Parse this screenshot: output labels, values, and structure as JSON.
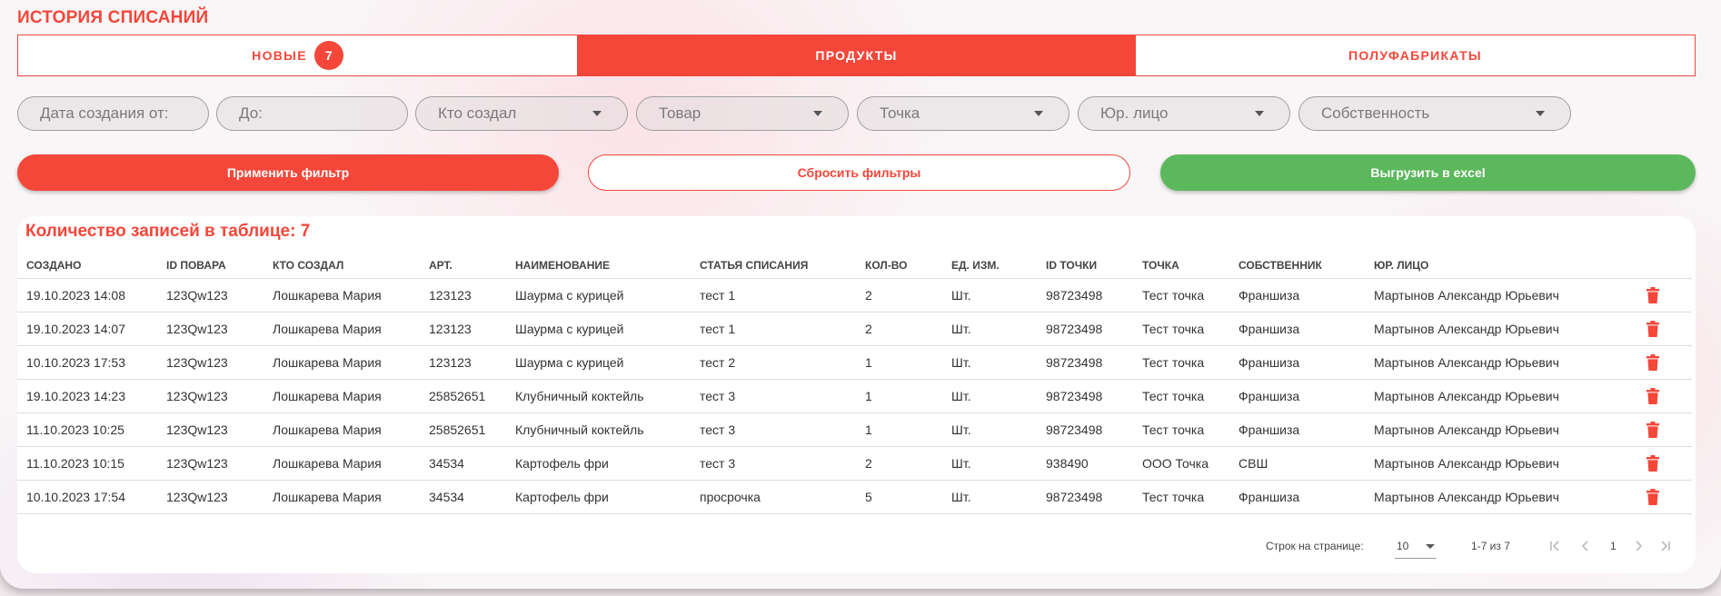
{
  "page": {
    "title": "ИСТОРИЯ СПИСАНИЙ"
  },
  "tabs": [
    {
      "label": "НОВЫЕ",
      "badge": "7"
    },
    {
      "label": "ПРОДУКТЫ"
    },
    {
      "label": "ПОЛУФАБРИКАТЫ"
    }
  ],
  "filters": {
    "date_from": "Дата создания от:",
    "date_to": "До:",
    "creator": "Кто создал",
    "product": "Товар",
    "point": "Точка",
    "legal_entity": "Юр. лицо",
    "ownership": "Собственность"
  },
  "buttons": {
    "apply": "Применить фильтр",
    "reset": "Сбросить фильтры",
    "export": "Выгрузить в excel"
  },
  "table": {
    "count_label": "Количество записей в таблице: 7",
    "columns": [
      "Создано",
      "ID повара",
      "Кто создал",
      "Арт.",
      "Наименование",
      "Статья списания",
      "Кол-во",
      "Ед. изм.",
      "ID точки",
      "Точка",
      "Собственник",
      "Юр. лицо"
    ],
    "rows": [
      [
        "19.10.2023 14:08",
        "123Qw123",
        "Лошкарева Мария",
        "123123",
        "Шаурма с курицей",
        "тест 1",
        "2",
        "Шт.",
        "98723498",
        "Тест точка",
        "Франшиза",
        "Мартынов Александр Юрьевич"
      ],
      [
        "19.10.2023 14:07",
        "123Qw123",
        "Лошкарева Мария",
        "123123",
        "Шаурма с курицей",
        "тест 1",
        "2",
        "Шт.",
        "98723498",
        "Тест точка",
        "Франшиза",
        "Мартынов Александр Юрьевич"
      ],
      [
        "10.10.2023 17:53",
        "123Qw123",
        "Лошкарева Мария",
        "123123",
        "Шаурма с курицей",
        "тест 2",
        "1",
        "Шт.",
        "98723498",
        "Тест точка",
        "Франшиза",
        "Мартынов Александр Юрьевич"
      ],
      [
        "19.10.2023 14:23",
        "123Qw123",
        "Лошкарева Мария",
        "25852651",
        "Клубничный коктейль",
        "тест 3",
        "1",
        "Шт.",
        "98723498",
        "Тест точка",
        "Франшиза",
        "Мартынов Александр Юрьевич"
      ],
      [
        "11.10.2023 10:25",
        "123Qw123",
        "Лошкарева Мария",
        "25852651",
        "Клубничный коктейль",
        "тест 3",
        "1",
        "Шт.",
        "98723498",
        "Тест точка",
        "Франшиза",
        "Мартынов Александр Юрьевич"
      ],
      [
        "11.10.2023 10:15",
        "123Qw123",
        "Лошкарева Мария",
        "34534",
        "Картофель фри",
        "тест 3",
        "2",
        "Шт.",
        "938490",
        "ООО Точка",
        "СВШ",
        "Мартынов Александр Юрьевич"
      ],
      [
        "10.10.2023 17:54",
        "123Qw123",
        "Лошкарева Мария",
        "34534",
        "Картофель фри",
        "просрочка",
        "5",
        "Шт.",
        "98723498",
        "Тест точка",
        "Франшиза",
        "Мартынов Александр Юрьевич"
      ]
    ]
  },
  "pagination": {
    "rows_per_page_label": "Строк на странице:",
    "rows_per_page": "10",
    "range": "1-7 из 7",
    "current_page": "1"
  },
  "icons": {
    "delete": "trash-icon",
    "first_page": "first-page-icon",
    "prev_page": "chevron-left-icon",
    "next_page": "chevron-right-icon",
    "last_page": "last-page-icon"
  },
  "colors": {
    "accent": "#f4473a",
    "export": "#5cb85c",
    "delete_icon": "#f4473a"
  }
}
